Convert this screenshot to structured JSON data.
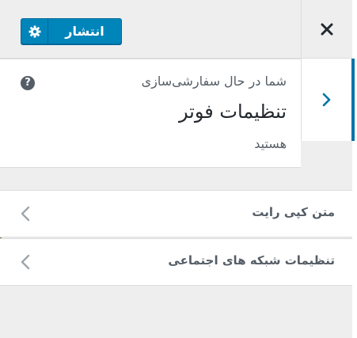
{
  "header": {
    "publish_label": "انتشار",
    "accent_color": "#0085ba"
  },
  "info": {
    "subtitle": "شما در حال سفارشی‌سازی",
    "title": "تنظیمات فوتر",
    "tail": "هستید"
  },
  "sections": [
    {
      "label": "متن کپی رایت"
    },
    {
      "label": "تنظیمات شبکه های اجتماعی"
    }
  ],
  "icons": {
    "publish_settings": "gear-icon",
    "close": "close-icon",
    "back": "chevron-right-icon",
    "help": "help-icon",
    "section_arrow": "chevron-left-icon"
  }
}
